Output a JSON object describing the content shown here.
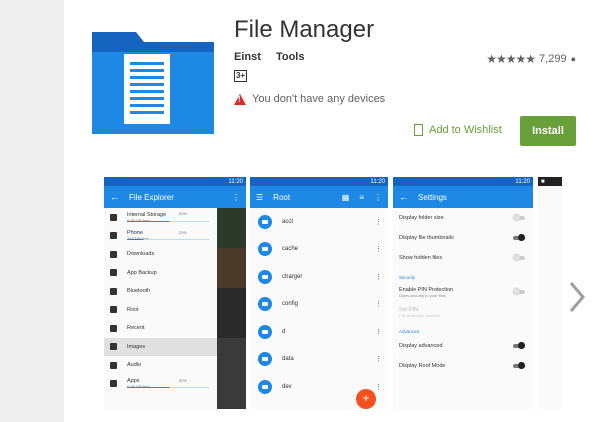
{
  "app": {
    "title": "File Manager",
    "developer": "Einst",
    "category": "Tools",
    "rating_count": "7,299",
    "age_rating": "3+",
    "warning": "You don't have any devices",
    "wishlist_label": "Add to Wishlist",
    "install_label": "Install"
  },
  "colors": {
    "install": "#689f38",
    "appbar": "#1e88e5",
    "statusbar": "#1565c0",
    "fab": "#f4511e",
    "warning": "#d32f2f"
  },
  "screens": {
    "status_time": "11:20",
    "explorer": {
      "title": "File Explorer",
      "items": [
        {
          "label": "Internal Storage",
          "sub": "6.39 GB free",
          "pct": "52%",
          "icon": "storage-icon",
          "progress": 0.52
        },
        {
          "label": "Phone",
          "sub": "394 MB free",
          "pct": "20%",
          "icon": "phone-icon",
          "progress": 0.2
        },
        {
          "label": "Downloads",
          "sub": "",
          "pct": "",
          "icon": "download-icon"
        },
        {
          "label": "App Backup",
          "sub": "",
          "pct": "",
          "icon": "folder-icon"
        },
        {
          "label": "Bluetooth",
          "sub": "",
          "pct": "",
          "icon": "bluetooth-icon"
        },
        {
          "label": "Root",
          "sub": "",
          "pct": "",
          "icon": "hash-icon"
        },
        {
          "label": "Recent",
          "sub": "",
          "pct": "",
          "icon": "clock-icon"
        },
        {
          "label": "Images",
          "sub": "",
          "pct": "",
          "icon": "image-icon",
          "active": true
        },
        {
          "label": "Audio",
          "sub": "",
          "pct": "",
          "icon": "headphones-icon"
        },
        {
          "label": "Apps",
          "sub": "6.39 GB free",
          "pct": "52%",
          "icon": "apps-icon",
          "progress": 0.52
        }
      ]
    },
    "root": {
      "title": "Root",
      "folders": [
        "acct",
        "cache",
        "charger",
        "config",
        "d",
        "data",
        "dev"
      ],
      "fab_label": "+"
    },
    "settings": {
      "title": "Settings",
      "rows": [
        {
          "type": "toggle",
          "label": "Display folder size",
          "on": false
        },
        {
          "type": "toggle",
          "label": "Display file thumbnails",
          "on": true
        },
        {
          "type": "toggle",
          "label": "Show hidden files",
          "on": false
        },
        {
          "type": "section",
          "label": "Security"
        },
        {
          "type": "toggle",
          "label": "Enable PIN Protection",
          "sub": "Gives security to your files",
          "on": false
        },
        {
          "type": "text",
          "label": "Set PIN",
          "sub": "PIN protection disabled",
          "dim": true
        },
        {
          "type": "section",
          "label": "Advanced"
        },
        {
          "type": "toggle",
          "label": "Display advanced",
          "on": true
        },
        {
          "type": "toggle",
          "label": "Display Root Mode",
          "on": true
        }
      ]
    }
  }
}
